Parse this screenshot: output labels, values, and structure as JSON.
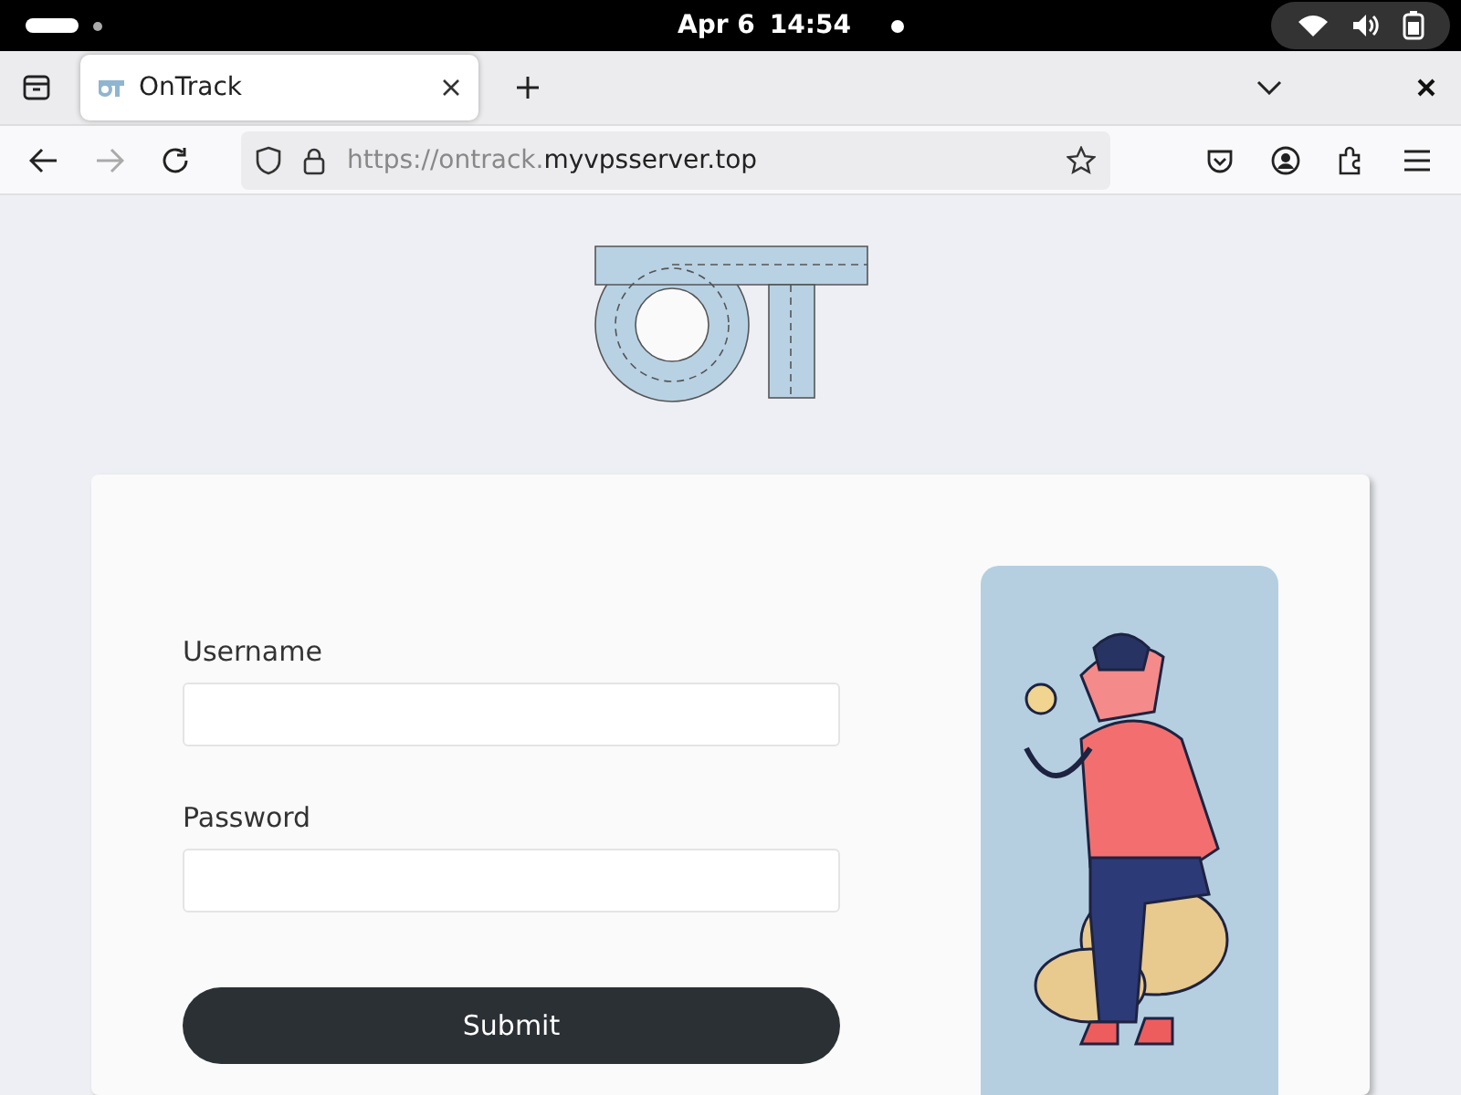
{
  "top_bar": {
    "date": "Apr 6",
    "time": "14:54"
  },
  "tabs": [
    {
      "title": "OnTrack",
      "selected": true
    }
  ],
  "address_bar": {
    "url_prefix": "https://ontrack.",
    "url_domain": "myvpsserver.top"
  },
  "login_form": {
    "fields": [
      {
        "label": "Username"
      },
      {
        "label": "Password"
      }
    ],
    "submit": "Submit"
  }
}
